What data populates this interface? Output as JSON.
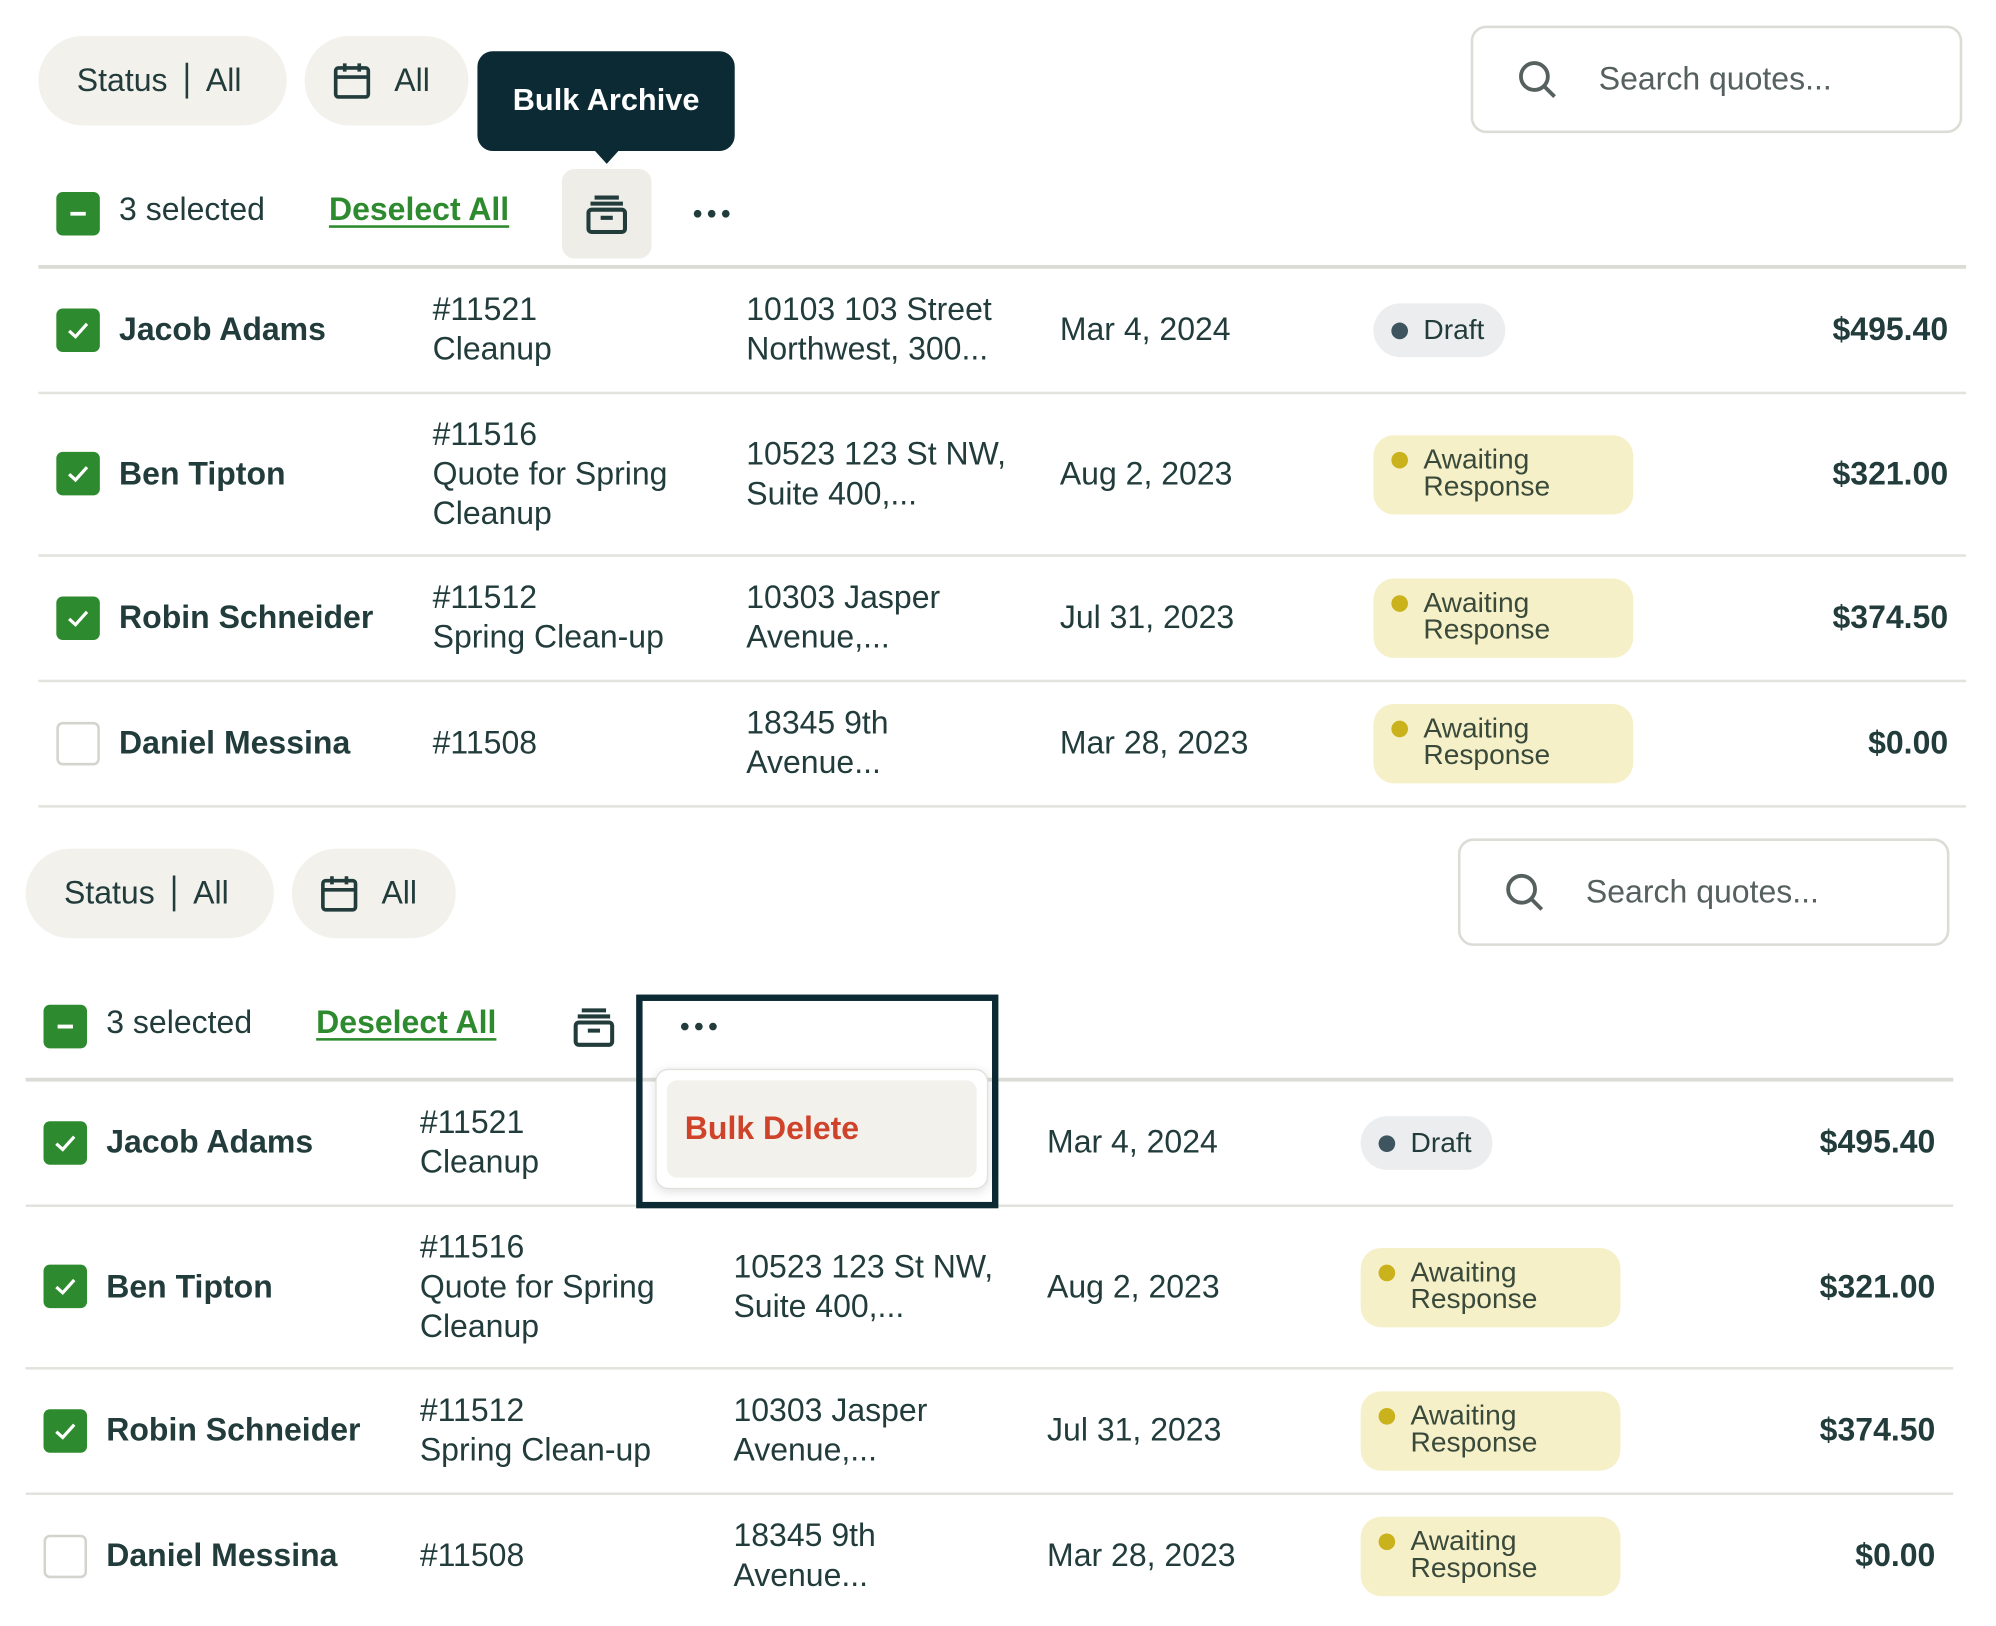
{
  "filters": {
    "status_label": "Status",
    "status_value": "All",
    "date_value": "All"
  },
  "search": {
    "placeholder": "Search quotes..."
  },
  "bulk": {
    "selected_text": "3 selected",
    "deselect_label": "Deselect All",
    "archive_tooltip": "Bulk Archive",
    "delete_label": "Bulk Delete"
  },
  "icons": {
    "filter_date": "calendar-icon",
    "search": "search-icon",
    "archive": "archive-box-icon",
    "more": "more-horizontal-icon",
    "check": "check-icon",
    "indeterminate": "minus-icon"
  },
  "colors": {
    "accent_green": "#2e8a2e",
    "tooltip_bg": "#0b2a33",
    "danger": "#d0432b",
    "awaiting_bg": "#f6f0c9",
    "draft_bg": "#ecedef"
  },
  "rows": [
    {
      "checked": true,
      "name": "Jacob Adams",
      "quote_number": "#11521",
      "quote_title": "Cleanup",
      "address_line1": "10103 103 Street",
      "address_line2": "Northwest, 300...",
      "date": "Mar 4, 2024",
      "status": "Draft",
      "status_line1": "Draft",
      "status_line2": "",
      "total": "$495.40"
    },
    {
      "checked": true,
      "name": "Ben Tipton",
      "quote_number": "#11516",
      "quote_title": "Quote for Spring",
      "quote_title2": "Cleanup",
      "address_line1": "10523 123 St NW,",
      "address_line2": "Suite 400,...",
      "date": "Aug 2, 2023",
      "status": "Awaiting Response",
      "status_line1": "Awaiting",
      "status_line2": "Response",
      "total": "$321.00"
    },
    {
      "checked": true,
      "name": "Robin Schneider",
      "quote_number": "#11512",
      "quote_title": "Spring Clean-up",
      "address_line1": "10303 Jasper",
      "address_line2": "Avenue,...",
      "date": "Jul 31, 2023",
      "status": "Awaiting Response",
      "status_line1": "Awaiting",
      "status_line2": "Response",
      "total": "$374.50"
    },
    {
      "checked": false,
      "name": "Daniel Messina",
      "quote_number": "#11508",
      "quote_title": "",
      "address_line1": "18345 9th",
      "address_line2": "Avenue...",
      "date": "Mar 28, 2023",
      "status": "Awaiting Response",
      "status_line1": "Awaiting",
      "status_line2": "Response",
      "total": "$0.00"
    }
  ]
}
